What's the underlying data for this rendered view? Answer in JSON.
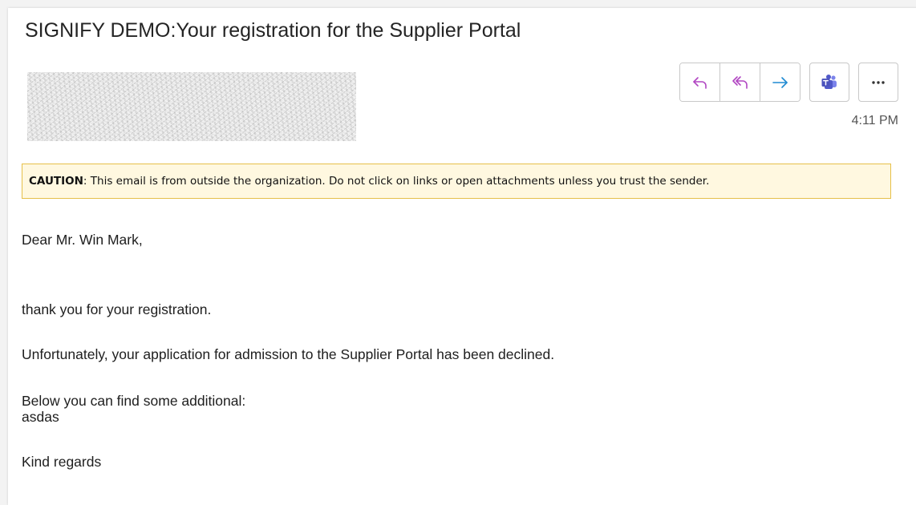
{
  "email": {
    "subject": "SIGNIFY DEMO:Your registration for the Supplier Portal",
    "time": "4:11 PM",
    "caution": {
      "label": "CAUTION",
      "text": ": This email is from outside the organization. Do not click on links or open attachments unless you trust the sender."
    },
    "body": {
      "greeting": "Dear Mr. Win Mark,",
      "line1": "thank you for your registration.",
      "line2": "Unfortunately, your application for admission to the Supplier Portal has been declined.",
      "line3": "Below you can find some additional:",
      "line4": "asdas",
      "closing": "Kind regards"
    }
  },
  "toolbar": {
    "icons": [
      "reply-icon",
      "reply-all-icon",
      "forward-icon",
      "teams-icon",
      "more-options-icon"
    ],
    "colors": {
      "reply": "#b146c2",
      "forward": "#1f8ad2",
      "teams": "#4b53bc"
    }
  },
  "colors": {
    "caution_background": "#fff8e0",
    "caution_border": "#e6c04a"
  }
}
